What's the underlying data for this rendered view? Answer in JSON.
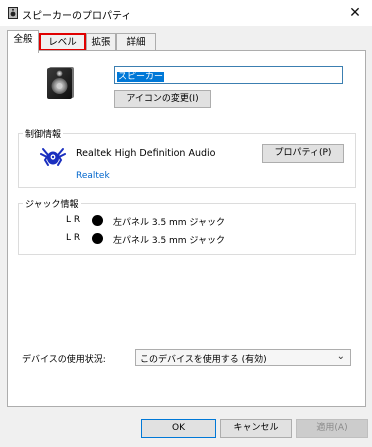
{
  "window": {
    "title": "スピーカーのプロパティ",
    "close_glyph": "✕"
  },
  "tabs": [
    {
      "label": "全般",
      "active": true
    },
    {
      "label": "レベル",
      "active": false,
      "highlighted": true
    },
    {
      "label": "拡張",
      "active": false
    },
    {
      "label": "詳細",
      "active": false
    }
  ],
  "general": {
    "device_name": "スピーカー",
    "change_icon_button": "アイコンの変更(I)"
  },
  "controller": {
    "group_label": "制御情報",
    "name": "Realtek High Definition Audio",
    "properties_button": "プロパティ(P)",
    "link": "Realtek"
  },
  "jack": {
    "group_label": "ジャック情報",
    "rows": [
      {
        "channels": "L R",
        "description": "左パネル 3.5 mm ジャック"
      },
      {
        "channels": "L R",
        "description": "左パネル 3.5 mm ジャック"
      }
    ]
  },
  "device_usage": {
    "label": "デバイスの使用状況:",
    "selected": "このデバイスを使用する (有効)",
    "arrow_glyph": "⌄"
  },
  "buttons": {
    "ok": "OK",
    "cancel": "キャンセル",
    "apply": "適用(A)"
  },
  "colors": {
    "highlight_red": "#e00000",
    "link_blue": "#0066cc",
    "selection_blue": "#0078d7"
  }
}
